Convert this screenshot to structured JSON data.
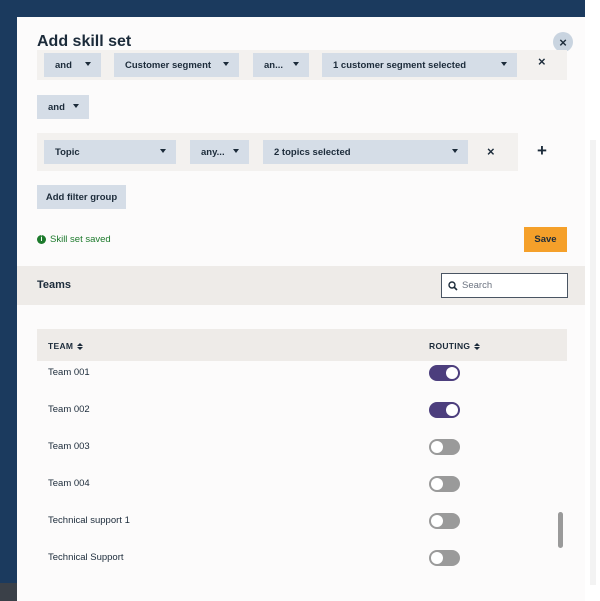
{
  "modal": {
    "title": "Add skill set",
    "close_icon": "×"
  },
  "filters": {
    "top_row": {
      "operator": "and",
      "field": "Customer segment",
      "condition": "an...",
      "value": "1 customer segment selected",
      "remove_icon": "×"
    },
    "join_operator": "and",
    "mid_row": {
      "field": "Topic",
      "condition": "any...",
      "value": "2 topics selected",
      "remove_icon": "×",
      "add_icon": "+"
    },
    "add_group_label": "Add filter group"
  },
  "status": {
    "saved_text": "Skill set saved",
    "saved_icon": "info-icon"
  },
  "save_label": "Save",
  "teams": {
    "title": "Teams",
    "search_placeholder": "Search",
    "columns": [
      "TEAM",
      "ROUTING"
    ],
    "rows": [
      {
        "name": "Team 001",
        "routing": true
      },
      {
        "name": "Team 002",
        "routing": true
      },
      {
        "name": "Team 003",
        "routing": false
      },
      {
        "name": "Team 004",
        "routing": false
      },
      {
        "name": "Technical support 1",
        "routing": false
      },
      {
        "name": "Technical Support",
        "routing": false
      }
    ]
  },
  "colors": {
    "accent": "#f5a02a",
    "toggle_on": "#4c3e7d",
    "toggle_off": "#9a9a9a",
    "success": "#1d7a2c",
    "backdrop": "#1b3a5e"
  }
}
